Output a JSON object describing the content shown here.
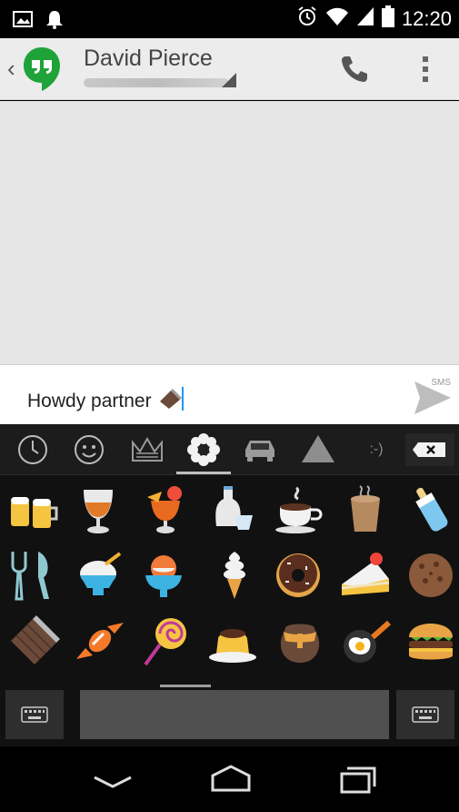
{
  "status_bar": {
    "time": "12:20",
    "icons": [
      "gallery-icon",
      "notification-bell-icon",
      "alarm-icon",
      "wifi-icon",
      "signal-icon",
      "battery-icon"
    ]
  },
  "action_bar": {
    "contact_name": "David Pierce",
    "icons": [
      "back-caret-icon",
      "hangouts-logo-icon",
      "phone-icon",
      "overflow-menu-icon"
    ]
  },
  "compose": {
    "text": "Howdy partner",
    "send_label": "SMS"
  },
  "keyboard": {
    "categories": [
      "recent-clock-icon",
      "smiley-icon",
      "crown-icon",
      "flower-icon",
      "car-icon",
      "triangle-icon",
      "emoticon-text-icon"
    ],
    "emoticon_text": ":-)",
    "selected_category": "flower-icon",
    "emojis": [
      "beer-mugs",
      "brandy-glass",
      "tropical-drink",
      "sake",
      "coffee",
      "tea-cup",
      "baby-bottle",
      "fork-knife",
      "shaved-ice",
      "ice-cream",
      "soft-serve",
      "doughnut",
      "shortcake",
      "cookie",
      "chocolate-bar",
      "candy",
      "lollipop",
      "custard",
      "honey-pot",
      "cooking-egg",
      "hamburger"
    ]
  },
  "colors": {
    "hangouts_green": "#1fa339",
    "conversation_bg": "#e6e6e6",
    "keyboard_bg": "#111111"
  }
}
